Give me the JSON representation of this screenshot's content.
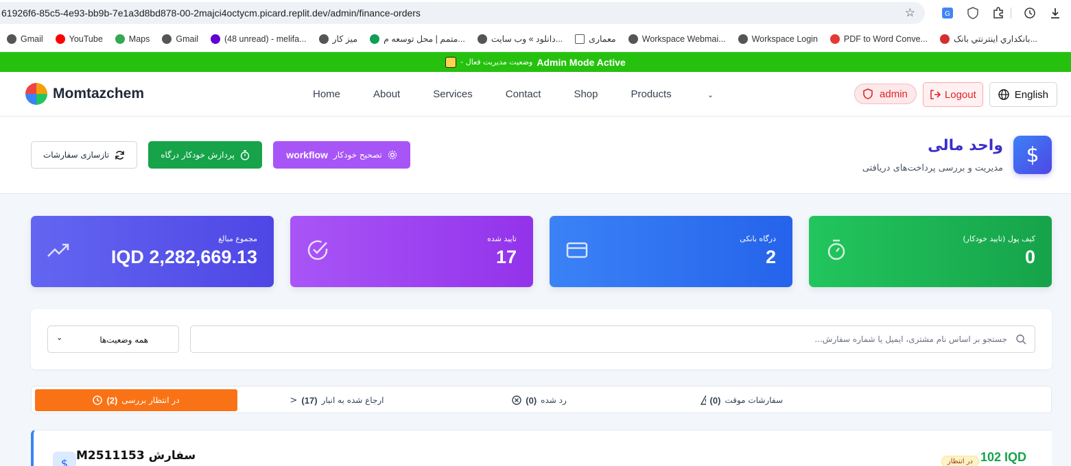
{
  "browser": {
    "url": "61926f6-85c5-4e93-bb9b-7e1a3d8bd878-00-2majci4octycm.picard.replit.dev/admin/finance-orders",
    "bookmarks": [
      {
        "label": "Gmail",
        "icon": "globe-icon",
        "color": "#555555"
      },
      {
        "label": "YouTube",
        "icon": "youtube-icon",
        "color": "#ff0000"
      },
      {
        "label": "Maps",
        "icon": "maps-icon",
        "color": "#34a853"
      },
      {
        "label": "Gmail",
        "icon": "globe-icon",
        "color": "#555555"
      },
      {
        "label": "(48 unread) - melifa...",
        "icon": "yahoo-icon",
        "color": "#6001d2"
      },
      {
        "label": "میز کار",
        "icon": "globe-icon",
        "color": "#555555"
      },
      {
        "label": "متمم | محل توسعه م...",
        "icon": "motamem-icon",
        "color": "#0f9d58"
      },
      {
        "label": "دانلود » وب سایت...",
        "icon": "globe-icon",
        "color": "#555555"
      },
      {
        "label": "معماری",
        "icon": "folder-icon",
        "color": "#555555"
      },
      {
        "label": "Workspace Webmai...",
        "icon": "globe-icon",
        "color": "#555555"
      },
      {
        "label": "Workspace Login",
        "icon": "globe-icon",
        "color": "#555555"
      },
      {
        "label": "PDF to Word Conve...",
        "icon": "pdf-icon",
        "color": "#e53935"
      },
      {
        "label": "بانكداري اينترنتي بانک...",
        "icon": "bank-icon",
        "color": "#d32f2f"
      }
    ]
  },
  "banner": {
    "bold": "Admin Mode Active",
    "rtl": "وضعیت مدیریت فعال -"
  },
  "nav": {
    "brand": "Momtazchem",
    "links": [
      "Home",
      "About",
      "Services",
      "Contact",
      "Shop",
      "Products"
    ],
    "products_caret": "⌄",
    "admin_label": "admin",
    "logout_label": "Logout",
    "lang_label": "English"
  },
  "header": {
    "title": "واحد مالی",
    "subtitle": "مدیریت و بررسی پرداخت‌های دریافتی",
    "btn_workflow_text": "تصحیح خودکار",
    "btn_workflow_bold": "workflow",
    "btn_gateway": "پردازش خودکار درگاه",
    "btn_refresh": "تازسازی سفارشات"
  },
  "stats": {
    "total_label": "مجموع مبالغ",
    "total_value": "IQD 2,282,669.13",
    "approved_label": "تایید شده",
    "approved_value": "17",
    "bank_label": "درگاه بانکی",
    "bank_value": "2",
    "wallet_label": "کیف پول (تایید خودکار)",
    "wallet_value": "0"
  },
  "filter": {
    "search_placeholder": "جستجو بر اساس نام مشتری، ایمیل یا شماره سفارش...",
    "status_value": "همه وضعیت‌ها"
  },
  "tabs": {
    "pending_label": "در انتظار بررسی",
    "pending_count": "(2)",
    "returned_label": "ارجاع شده به انبار",
    "returned_count": "(17)",
    "rejected_label": "رد شده",
    "rejected_count": "(0)",
    "temp_label": "سفارشات موقت",
    "temp_count": "(0)"
  },
  "order": {
    "title_prefix": "سفارش",
    "number": "M2511153",
    "amount": "102 IQD",
    "badge": "در انتظار"
  }
}
